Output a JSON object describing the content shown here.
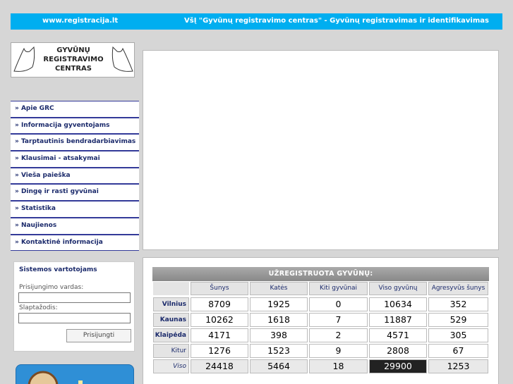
{
  "header": {
    "site": "www.registracija.lt",
    "org": "VšĮ \"Gyvūnų registravimo centras\" - Gyvūnų registravimas ir identifikavimas"
  },
  "logo": {
    "line1": "GYVŪNŲ",
    "line2": "REGISTRAVIMO",
    "line3": "CENTRAS"
  },
  "menu": [
    "» Apie GRC",
    "» Informacija gyventojams",
    "» Tarptautinis bendradarbiavimas",
    "» Klausimai - atsakymai",
    "» Viešа paieška",
    "» Dingę ir rasti gyvūnai",
    "» Statistika",
    "» Naujienos",
    "» Kontaktinė informacija"
  ],
  "login": {
    "title": "Sistemos vartotojams",
    "username_label": "Prisijungimo vardas:",
    "password_label": "Slaptažodis:",
    "button": "Prisijungti"
  },
  "stats": {
    "title": "UŽREGISTRUOTA GYVŪNŲ:",
    "columns": [
      "Šunys",
      "Katės",
      "Kiti gyvūnai",
      "Viso gyvūnų",
      "Agresyvūs šunys"
    ],
    "rows": [
      {
        "label": "Vilnius",
        "values": [
          "8709",
          "1925",
          "0",
          "10634",
          "352"
        ]
      },
      {
        "label": "Kaunas",
        "values": [
          "10262",
          "1618",
          "7",
          "11887",
          "529"
        ]
      },
      {
        "label": "Klaipėda",
        "values": [
          "4171",
          "398",
          "2",
          "4571",
          "305"
        ]
      },
      {
        "label": "Kitur",
        "values": [
          "1276",
          "1523",
          "9",
          "2808",
          "67"
        ]
      },
      {
        "label": "Viso",
        "values": [
          "24418",
          "5464",
          "18",
          "29900",
          "1253"
        ]
      }
    ]
  }
}
